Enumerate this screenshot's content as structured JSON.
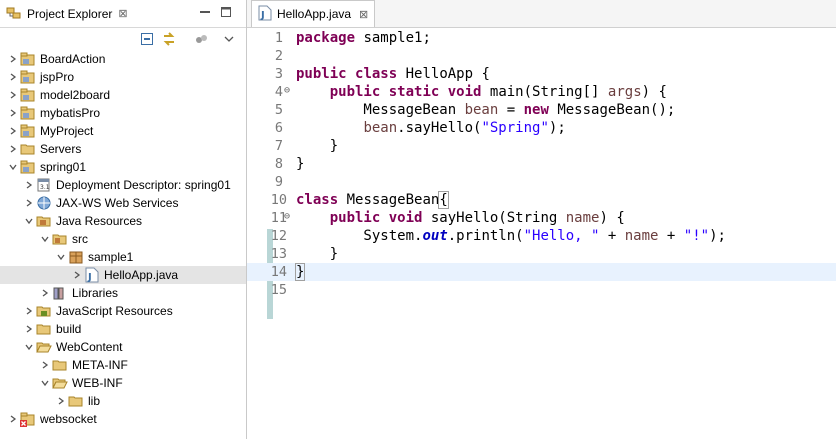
{
  "explorer": {
    "tab_label": "Project Explorer",
    "tab_close": "⊠",
    "tree": [
      {
        "label": "BoardAction",
        "icon": "project-icon",
        "expanded": false
      },
      {
        "label": "jspPro",
        "icon": "project-icon",
        "expanded": false
      },
      {
        "label": "model2board",
        "icon": "project-icon",
        "expanded": false
      },
      {
        "label": "mybatisPro",
        "icon": "project-icon",
        "expanded": false
      },
      {
        "label": "MyProject",
        "icon": "project-icon",
        "expanded": false
      },
      {
        "label": "Servers",
        "icon": "folder-icon",
        "expanded": false
      },
      {
        "label": "spring01",
        "icon": "project-icon",
        "expanded": true
      },
      {
        "label": "Deployment Descriptor: spring01",
        "icon": "descriptor-icon",
        "expanded": false
      },
      {
        "label": "JAX-WS Web Services",
        "icon": "webservice-icon",
        "expanded": false
      },
      {
        "label": "Java Resources",
        "icon": "java-resources-icon",
        "expanded": true
      },
      {
        "label": "src",
        "icon": "source-folder-icon",
        "expanded": true
      },
      {
        "label": "sample1",
        "icon": "package-icon",
        "expanded": true
      },
      {
        "label": "HelloApp.java",
        "icon": "java-file-icon",
        "expanded": false,
        "selected": true
      },
      {
        "label": "Libraries",
        "icon": "libraries-icon",
        "expanded": false
      },
      {
        "label": "JavaScript Resources",
        "icon": "js-resources-icon",
        "expanded": false
      },
      {
        "label": "build",
        "icon": "folder-icon",
        "expanded": false
      },
      {
        "label": "WebContent",
        "icon": "folder-open-icon",
        "expanded": true
      },
      {
        "label": "META-INF",
        "icon": "folder-icon",
        "expanded": false
      },
      {
        "label": "WEB-INF",
        "icon": "folder-open-icon",
        "expanded": true
      },
      {
        "label": "lib",
        "icon": "folder-icon",
        "expanded": false
      },
      {
        "label": "websocket",
        "icon": "project-error-icon",
        "expanded": false
      }
    ]
  },
  "editor": {
    "tab_label": "HelloApp.java",
    "tab_close": "⊠",
    "line_numbers": [
      "1",
      "2",
      "3",
      "4",
      "5",
      "6",
      "7",
      "8",
      "9",
      "10",
      "11",
      "12",
      "13",
      "14",
      "15"
    ]
  },
  "colors": {
    "keyword": "#7f0055",
    "string": "#2a00ff",
    "field": "#0000c0",
    "current_line": "#e8f2fe"
  }
}
